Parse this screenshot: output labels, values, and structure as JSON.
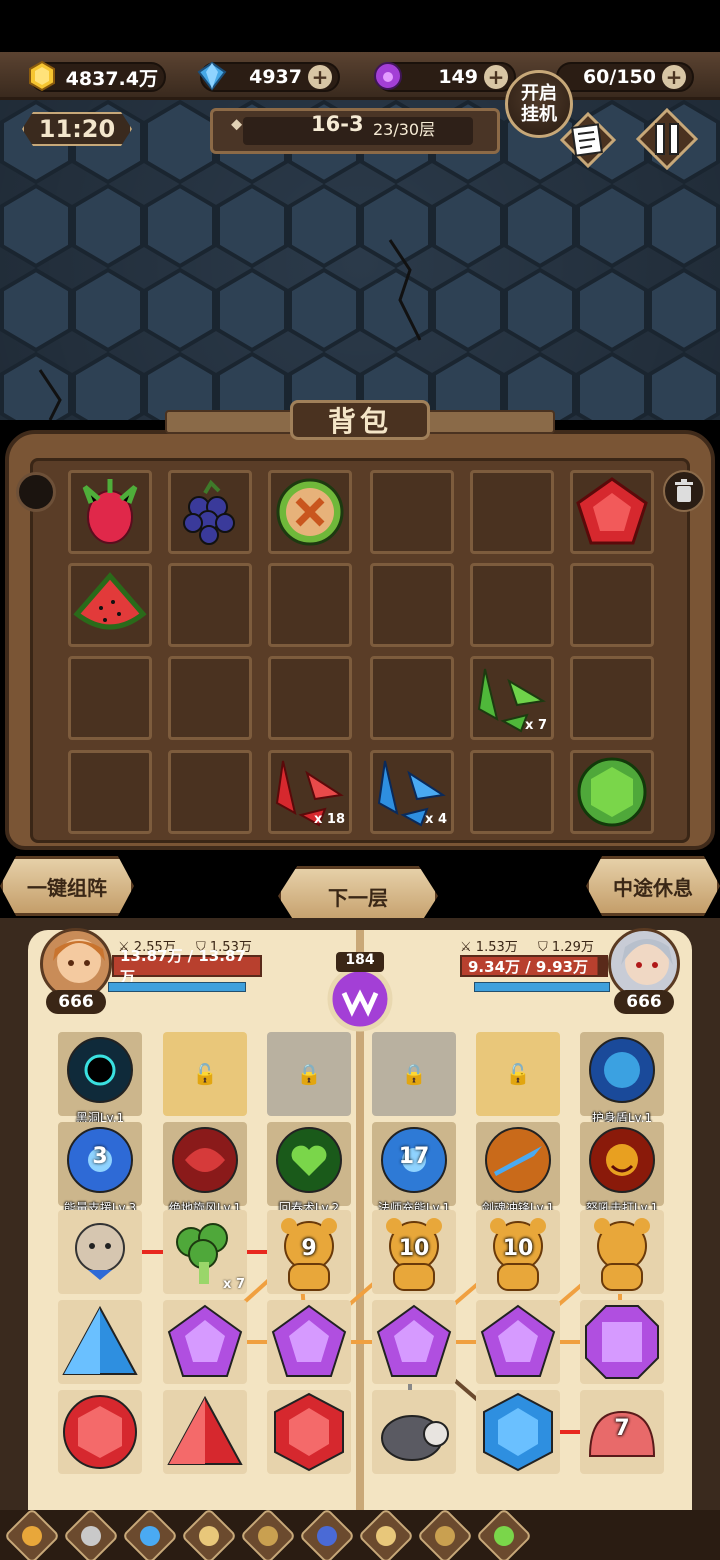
{
  "resources": {
    "gold": "4837.4万",
    "diamond": "4937",
    "potion": "149",
    "stamina": "60/150"
  },
  "auto_button": "开启\n挂机",
  "auto_line1": "开启",
  "auto_line2": "挂机",
  "clock": "11:20",
  "stage": {
    "level": "16-3",
    "floor": "23/30层"
  },
  "backpack": {
    "title": "背包",
    "items": [
      {
        "name": "dragonfruit",
        "qty": ""
      },
      {
        "name": "blackberry",
        "qty": ""
      },
      {
        "name": "green-rune-orb",
        "qty": ""
      },
      {
        "name": "red-pentagon-gem",
        "qty": ""
      },
      {
        "name": "watermelon-slice",
        "qty": ""
      },
      {
        "name": "green-crystal-shards",
        "qty": "x 7"
      },
      {
        "name": "red-crystal-shards",
        "qty": "x 18"
      },
      {
        "name": "blue-crystal-shards",
        "qty": "x 4"
      },
      {
        "name": "green-round-gem",
        "qty": ""
      }
    ]
  },
  "buttons": {
    "auto_formation": "一键组阵",
    "next_floor": "下一层",
    "rest": "中途休息"
  },
  "battle": {
    "turns": "184",
    "player": {
      "level": "666",
      "attack": "2.55万",
      "defense": "1.53万",
      "hp": "13.87万 / 13.87万",
      "hp_fraction": 1.0
    },
    "enemy": {
      "level": "666",
      "attack": "1.53万",
      "defense": "1.29万",
      "hp": "9.34万 / 9.93万",
      "hp_fraction": 0.94
    },
    "skills_left": [
      {
        "label": "黑洞Lv.1",
        "num": ""
      },
      {
        "label": "能量支援Lv.3",
        "num": "3"
      },
      {
        "label": "绝地旋风Lv.1",
        "num": ""
      },
      {
        "label": "回春术Lv.2",
        "num": ""
      }
    ],
    "skills_right": [
      {
        "label": "护身盾Lv.1",
        "num": ""
      },
      {
        "label": "法师充能Lv.1",
        "num": "17"
      },
      {
        "label": "剑魂冲锋Lv.1",
        "num": ""
      },
      {
        "label": "怒吼击打Lv.1",
        "num": ""
      }
    ],
    "board": {
      "broccoli_qty": "x 7",
      "bear_9": "9",
      "bear_10a": "10",
      "bear_10b": "10",
      "slime_7": "7"
    }
  },
  "colors": {
    "gold": "#f6c531",
    "diamond": "#47a8e6",
    "potion": "#a33fd6",
    "hp": "#b8402e",
    "mp": "#3fa0dc",
    "purple_gem": "#b04fe0",
    "red_gem": "#d6282e",
    "blue_gem": "#2e8fe0"
  }
}
